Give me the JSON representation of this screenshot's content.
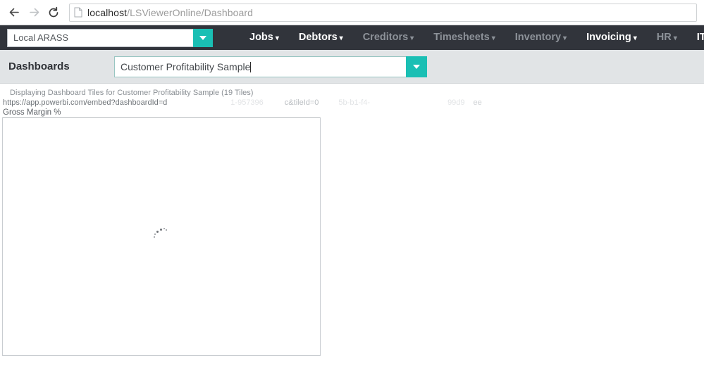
{
  "browser": {
    "back_icon": "back-arrow-icon",
    "forward_icon": "forward-arrow-icon",
    "reload_icon": "reload-icon",
    "page_icon": "page-document-icon",
    "url_host": "localhost",
    "url_path": "/LSViewerOnline/Dashboard"
  },
  "appnav": {
    "org_value": "Local ARASS",
    "org_placeholder": "Local ARASS",
    "dropdown_icon": "chevron-down-icon",
    "menu": [
      {
        "label": "Jobs",
        "caret": "▾",
        "active": true
      },
      {
        "label": "Debtors",
        "caret": "▾",
        "active": true
      },
      {
        "label": "Creditors",
        "caret": "▾",
        "active": false
      },
      {
        "label": "Timesheets",
        "caret": "▾",
        "active": false
      },
      {
        "label": "Inventory",
        "caret": "▾",
        "active": false
      },
      {
        "label": "Invoicing",
        "caret": "▾",
        "active": true
      },
      {
        "label": "HR",
        "caret": "▾",
        "active": false
      },
      {
        "label": "IT",
        "caret": "▾",
        "active": true
      }
    ]
  },
  "toolbar": {
    "label": "Dashboards",
    "dashboard_value": "Customer Profitability Sample",
    "dashboard_placeholder": "Customer Profitability Sample",
    "dropdown_icon": "chevron-down-icon"
  },
  "content": {
    "status_text": "Displaying Dashboard Tiles for Customer Profitability Sample (19 Tiles)",
    "embed_url_visible": "https://app.powerbi.com/embed?dashboardId=d",
    "embed_url_fragment_1": "1-957396",
    "embed_url_fragment_2": "c&tileId=0",
    "embed_url_fragment_3": "5b-b1-f4-",
    "embed_url_fragment_4": "99d9",
    "embed_url_fragment_5": "ee",
    "tile_title": "Gross Margin %",
    "tile_state": "loading"
  },
  "colors": {
    "accent_teal": "#1abfb4",
    "navbar_dark": "#31343b",
    "band_gray": "#e1e4e6"
  }
}
